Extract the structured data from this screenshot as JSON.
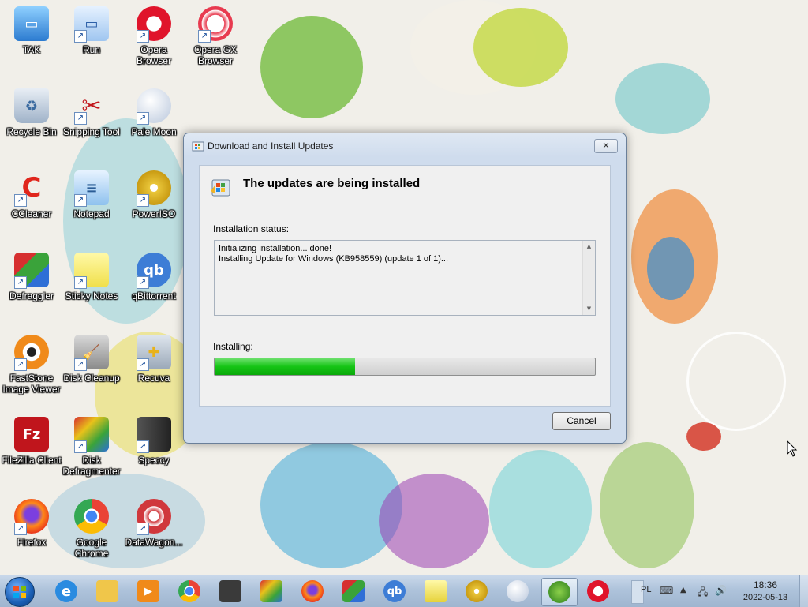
{
  "desktop": {
    "icons": [
      {
        "label": "TAK"
      },
      {
        "label": "Run"
      },
      {
        "label": "Opera Browser"
      },
      {
        "label": "Opera GX Browser"
      },
      {
        "label": "Recycle Bin"
      },
      {
        "label": "Snipping Tool"
      },
      {
        "label": "Pale Moon"
      },
      {
        "label": "CCleaner"
      },
      {
        "label": "Notepad"
      },
      {
        "label": "PowerISO"
      },
      {
        "label": "Defraggler"
      },
      {
        "label": "Sticky Notes"
      },
      {
        "label": "qBittorrent"
      },
      {
        "label": "FastStone Image Viewer"
      },
      {
        "label": "Disk Cleanup"
      },
      {
        "label": "Recuva"
      },
      {
        "label": "FileZilla Client"
      },
      {
        "label": "Disk Defragmenter"
      },
      {
        "label": "Speccy"
      },
      {
        "label": "Firefox"
      },
      {
        "label": "Google Chrome"
      },
      {
        "label": "DataWagon..."
      }
    ]
  },
  "dialog": {
    "title": "Download and Install Updates",
    "close_label": "✕",
    "heading": "The updates are being installed",
    "status_label": "Installation status:",
    "status_lines": [
      "Initializing installation... done!",
      "Installing Update for Windows (KB958559) (update 1 of 1)..."
    ],
    "installing_label": "Installing:",
    "progress_fraction": 0.37,
    "cancel_label": "Cancel"
  },
  "taskbar": {
    "icons": [
      {
        "name": "internet-explorer-icon"
      },
      {
        "name": "file-explorer-icon"
      },
      {
        "name": "media-player-icon"
      },
      {
        "name": "chrome-icon"
      },
      {
        "name": "speccy-icon"
      },
      {
        "name": "disk-defragmenter-icon"
      },
      {
        "name": "firefox-icon"
      },
      {
        "name": "defraggler-icon"
      },
      {
        "name": "qbittorrent-icon"
      },
      {
        "name": "sticky-notes-icon"
      },
      {
        "name": "poweriso-icon"
      },
      {
        "name": "pale-moon-icon"
      },
      {
        "name": "windows-update-icon"
      },
      {
        "name": "opera-icon"
      }
    ],
    "tray": {
      "language": "PL",
      "time": "18:36",
      "date": "2022-05-13"
    }
  },
  "colors": {
    "progress_fill": "#15c415",
    "dialog_frame": "#cfdced"
  }
}
